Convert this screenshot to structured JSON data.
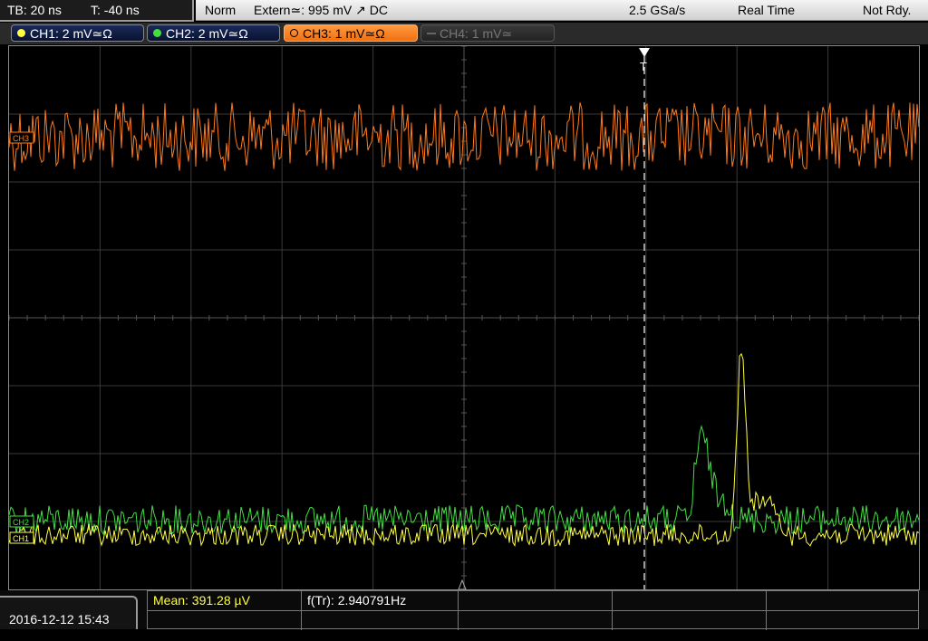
{
  "topbar": {
    "timebase": "TB: 20 ns",
    "trigger_time": "T: -40 ns",
    "mode": "Norm",
    "trigger_source": "Extern≃: 995 mV ↗ DC",
    "sample_rate": "2.5 GSa/s",
    "acq_mode": "Real Time",
    "status": "Not Rdy."
  },
  "channels": [
    {
      "label": "CH1: 2 mV≃Ω",
      "color": "#ffff40"
    },
    {
      "label": "CH2: 2 mV≃Ω",
      "color": "#40e040"
    },
    {
      "label": "CH3: 1 mV≃Ω",
      "color": "#ff7a1a"
    },
    {
      "label": "CH4: 1 mV≃",
      "color": "#666666"
    }
  ],
  "markers": {
    "trigger": "T",
    "ch3": "CH3",
    "ch2": "CH2",
    "ch1": "CH1"
  },
  "bottom": {
    "datetime": "2016-12-12 15:43",
    "mean": "Mean: 391.28 µV",
    "freq": "f(Tr): 2.940791Hz"
  },
  "colors": {
    "grid": "#3a3a3a",
    "ch1": "#ffff40",
    "ch2": "#40e040",
    "ch3": "#ff7a1a",
    "meas_mean": "#ffff40"
  }
}
